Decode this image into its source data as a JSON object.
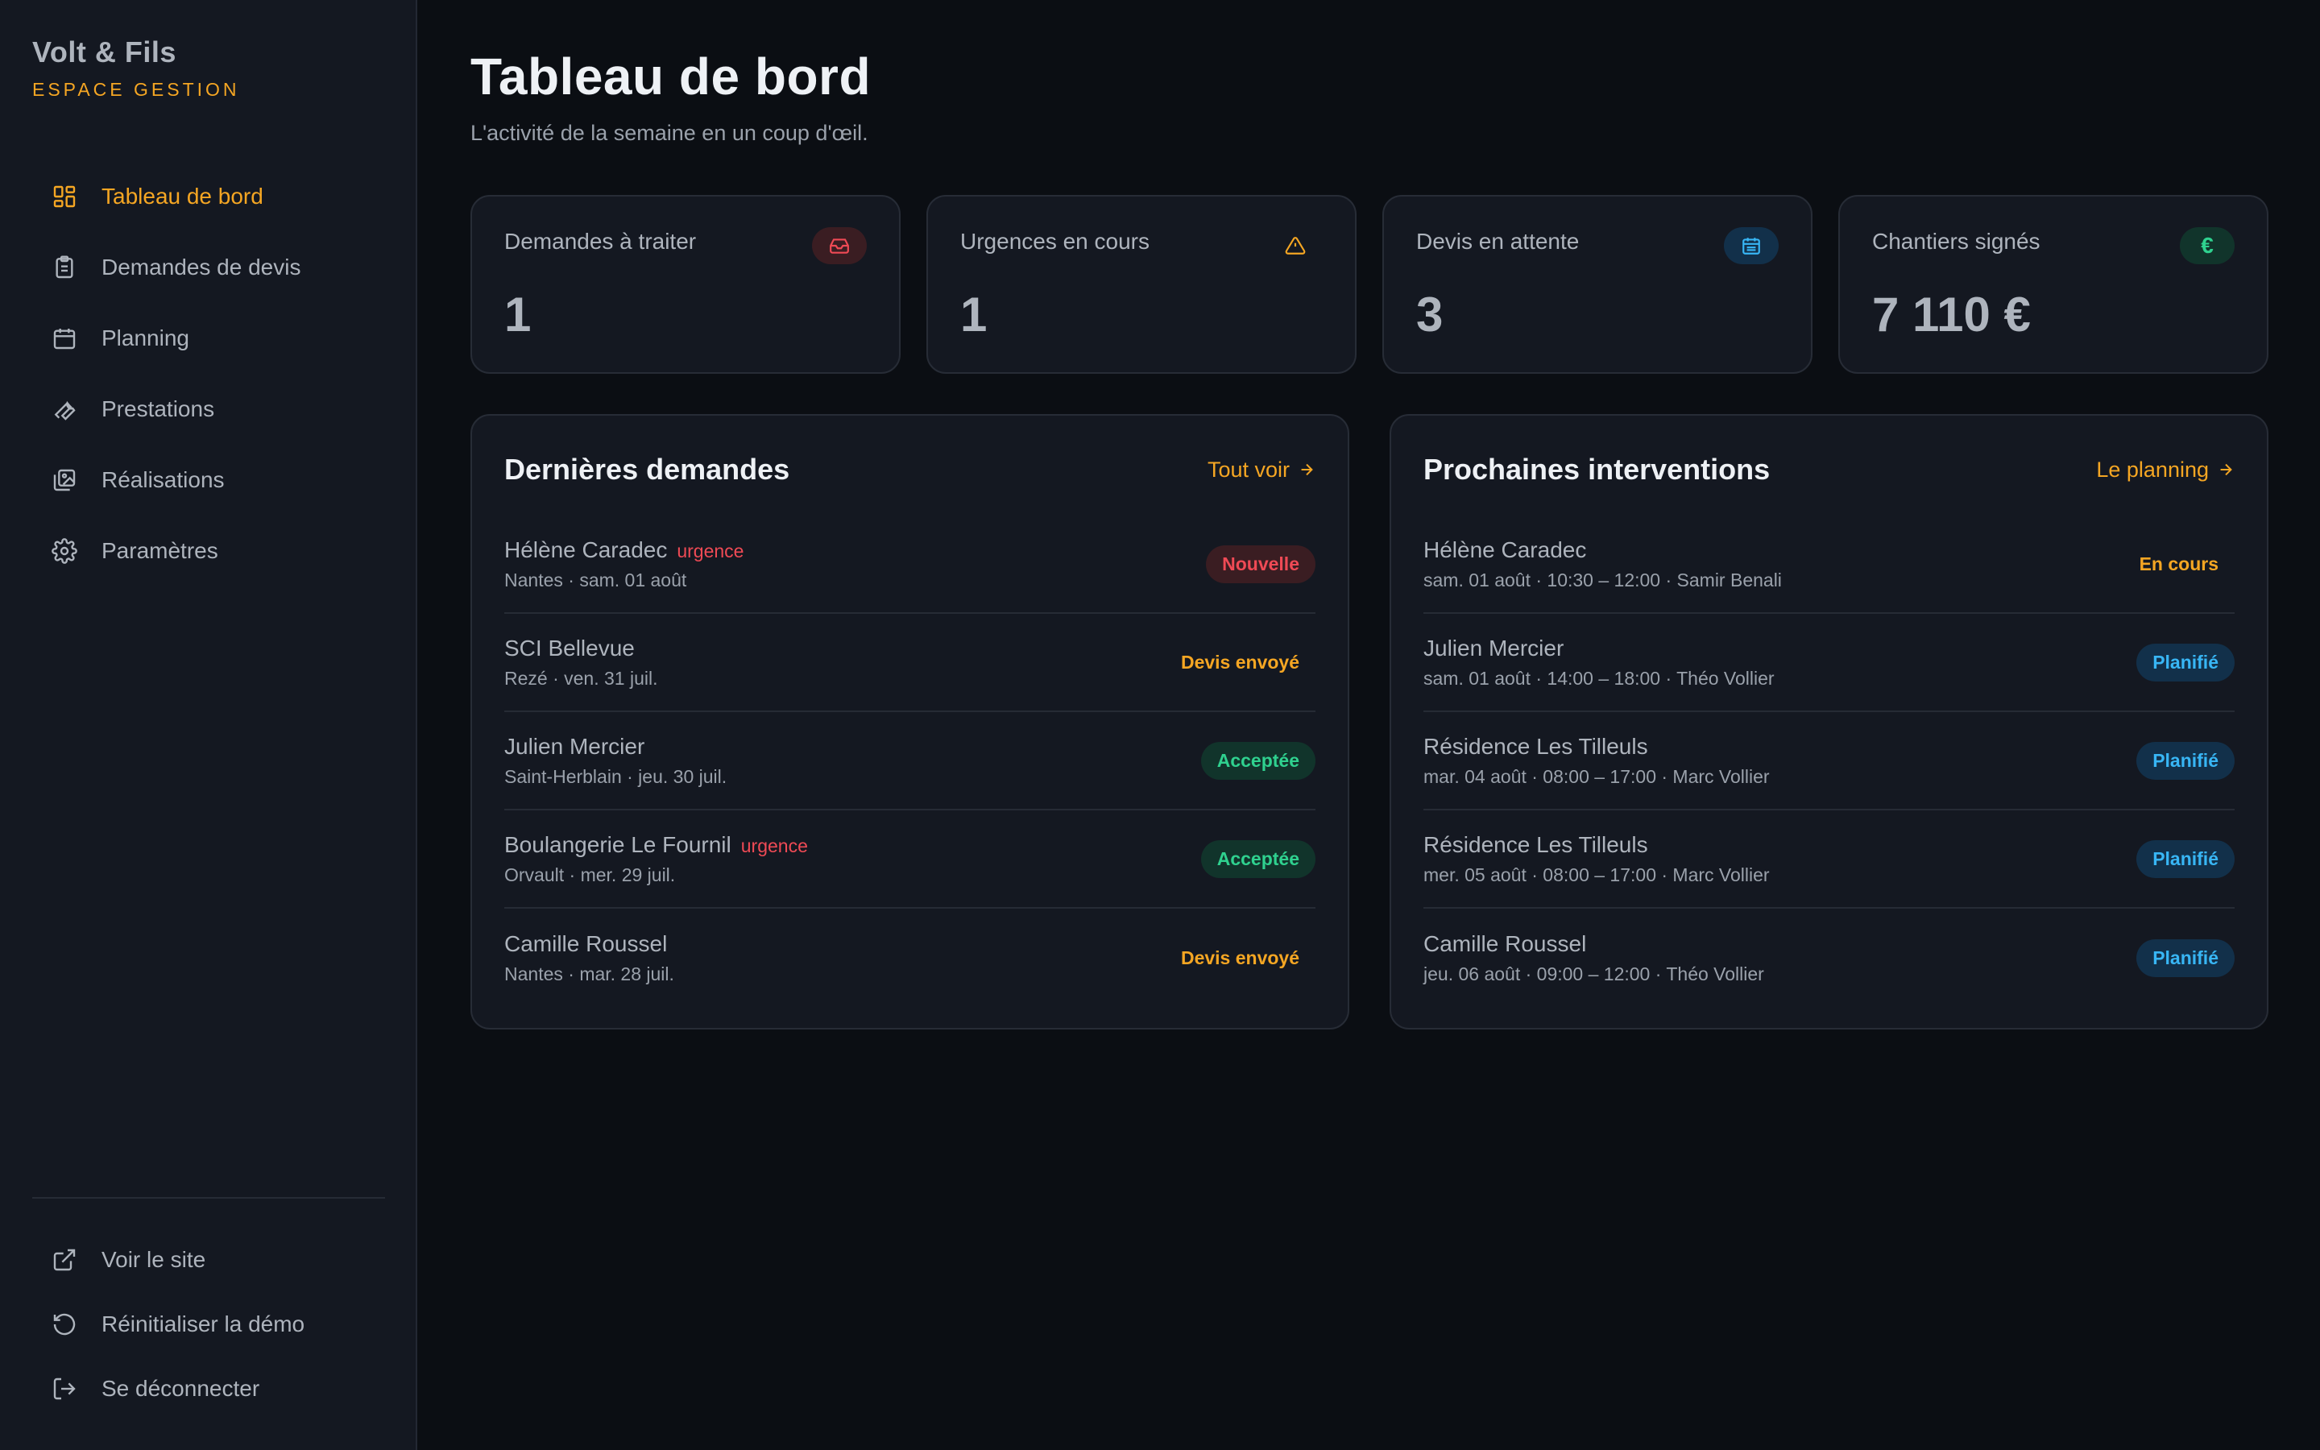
{
  "brand": {
    "name": "Volt & Fils",
    "subtitle": "ESPACE GESTION"
  },
  "nav": {
    "items": [
      {
        "label": "Tableau de bord",
        "icon": "dashboard-icon",
        "active": true
      },
      {
        "label": "Demandes de devis",
        "icon": "clipboard-icon"
      },
      {
        "label": "Planning",
        "icon": "calendar-icon"
      },
      {
        "label": "Prestations",
        "icon": "wrench-icon"
      },
      {
        "label": "Réalisations",
        "icon": "gallery-icon"
      },
      {
        "label": "Paramètres",
        "icon": "gear-icon"
      }
    ],
    "bottom": [
      {
        "label": "Voir le site",
        "icon": "external-link-icon"
      },
      {
        "label": "Réinitialiser la démo",
        "icon": "reset-icon"
      },
      {
        "label": "Se déconnecter",
        "icon": "logout-icon"
      }
    ]
  },
  "header": {
    "title": "Tableau de bord",
    "subtitle": "L'activité de la semaine en un coup d'œil."
  },
  "stats": [
    {
      "label": "Demandes à traiter",
      "value": "1",
      "icon": "inbox-icon",
      "color": "#ef4a55"
    },
    {
      "label": "Urgences en cours",
      "value": "1",
      "icon": "warning-icon",
      "color": "#f5a623"
    },
    {
      "label": "Devis en attente",
      "value": "3",
      "icon": "calendar-icon",
      "color": "#38b6f5"
    },
    {
      "label": "Chantiers signés",
      "value": "7 110 €",
      "icon": "euro-icon",
      "icon_text": "€",
      "color": "#2fd18f"
    }
  ],
  "requests": {
    "title": "Dernières demandes",
    "link": "Tout voir",
    "rows": [
      {
        "name": "Hélène Caradec",
        "urgent": "urgence",
        "meta": "Nantes · sam. 01 août",
        "status": "Nouvelle"
      },
      {
        "name": "SCI Bellevue",
        "urgent": "",
        "meta": "Rezé · ven. 31 juil.",
        "status": "Devis envoyé"
      },
      {
        "name": "Julien Mercier",
        "urgent": "",
        "meta": "Saint-Herblain · jeu. 30 juil.",
        "status": "Acceptée"
      },
      {
        "name": "Boulangerie Le Fournil",
        "urgent": "urgence",
        "meta": "Orvault · mer. 29 juil.",
        "status": "Acceptée"
      },
      {
        "name": "Camille Roussel",
        "urgent": "",
        "meta": "Nantes · mar. 28 juil.",
        "status": "Devis envoyé"
      }
    ]
  },
  "interventions": {
    "title": "Prochaines interventions",
    "link": "Le planning",
    "rows": [
      {
        "name": "Hélène Caradec",
        "meta": "sam. 01 août · 10:30 – 12:00 · Samir Benali",
        "status": "En cours"
      },
      {
        "name": "Julien Mercier",
        "meta": "sam. 01 août · 14:00 – 18:00 · Théo Vollier",
        "status": "Planifié"
      },
      {
        "name": "Résidence Les Tilleuls",
        "meta": "mar. 04 août · 08:00 – 17:00 · Marc Vollier",
        "status": "Planifié"
      },
      {
        "name": "Résidence Les Tilleuls",
        "meta": "mer. 05 août · 08:00 – 17:00 · Marc Vollier",
        "status": "Planifié"
      },
      {
        "name": "Camille Roussel",
        "meta": "jeu. 06 août · 09:00 – 12:00 · Théo Vollier",
        "status": "Planifié"
      }
    ]
  },
  "colors": {
    "accent": "#f5a623",
    "danger": "#ef4a55",
    "success": "#2fd18f",
    "info": "#38b6f5",
    "background": "#0b0e13",
    "surface": "#141821"
  }
}
